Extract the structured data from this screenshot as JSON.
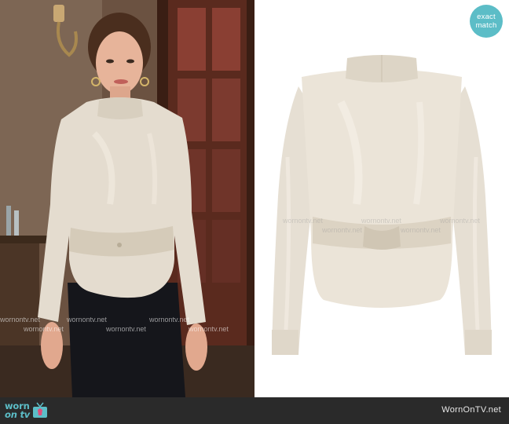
{
  "badge": {
    "line1": "exact",
    "line2": "match"
  },
  "watermark": {
    "text": "wornontv.net"
  },
  "footer": {
    "logo_line1": "worn",
    "logo_line2": "on tv",
    "site_name": "WornOnTV.net"
  },
  "colors": {
    "badge_bg": "#5cbdc7",
    "footer_bg": "#2a2a2a",
    "blouse": "#e4dccf"
  },
  "icons": [
    "tv-icon"
  ]
}
